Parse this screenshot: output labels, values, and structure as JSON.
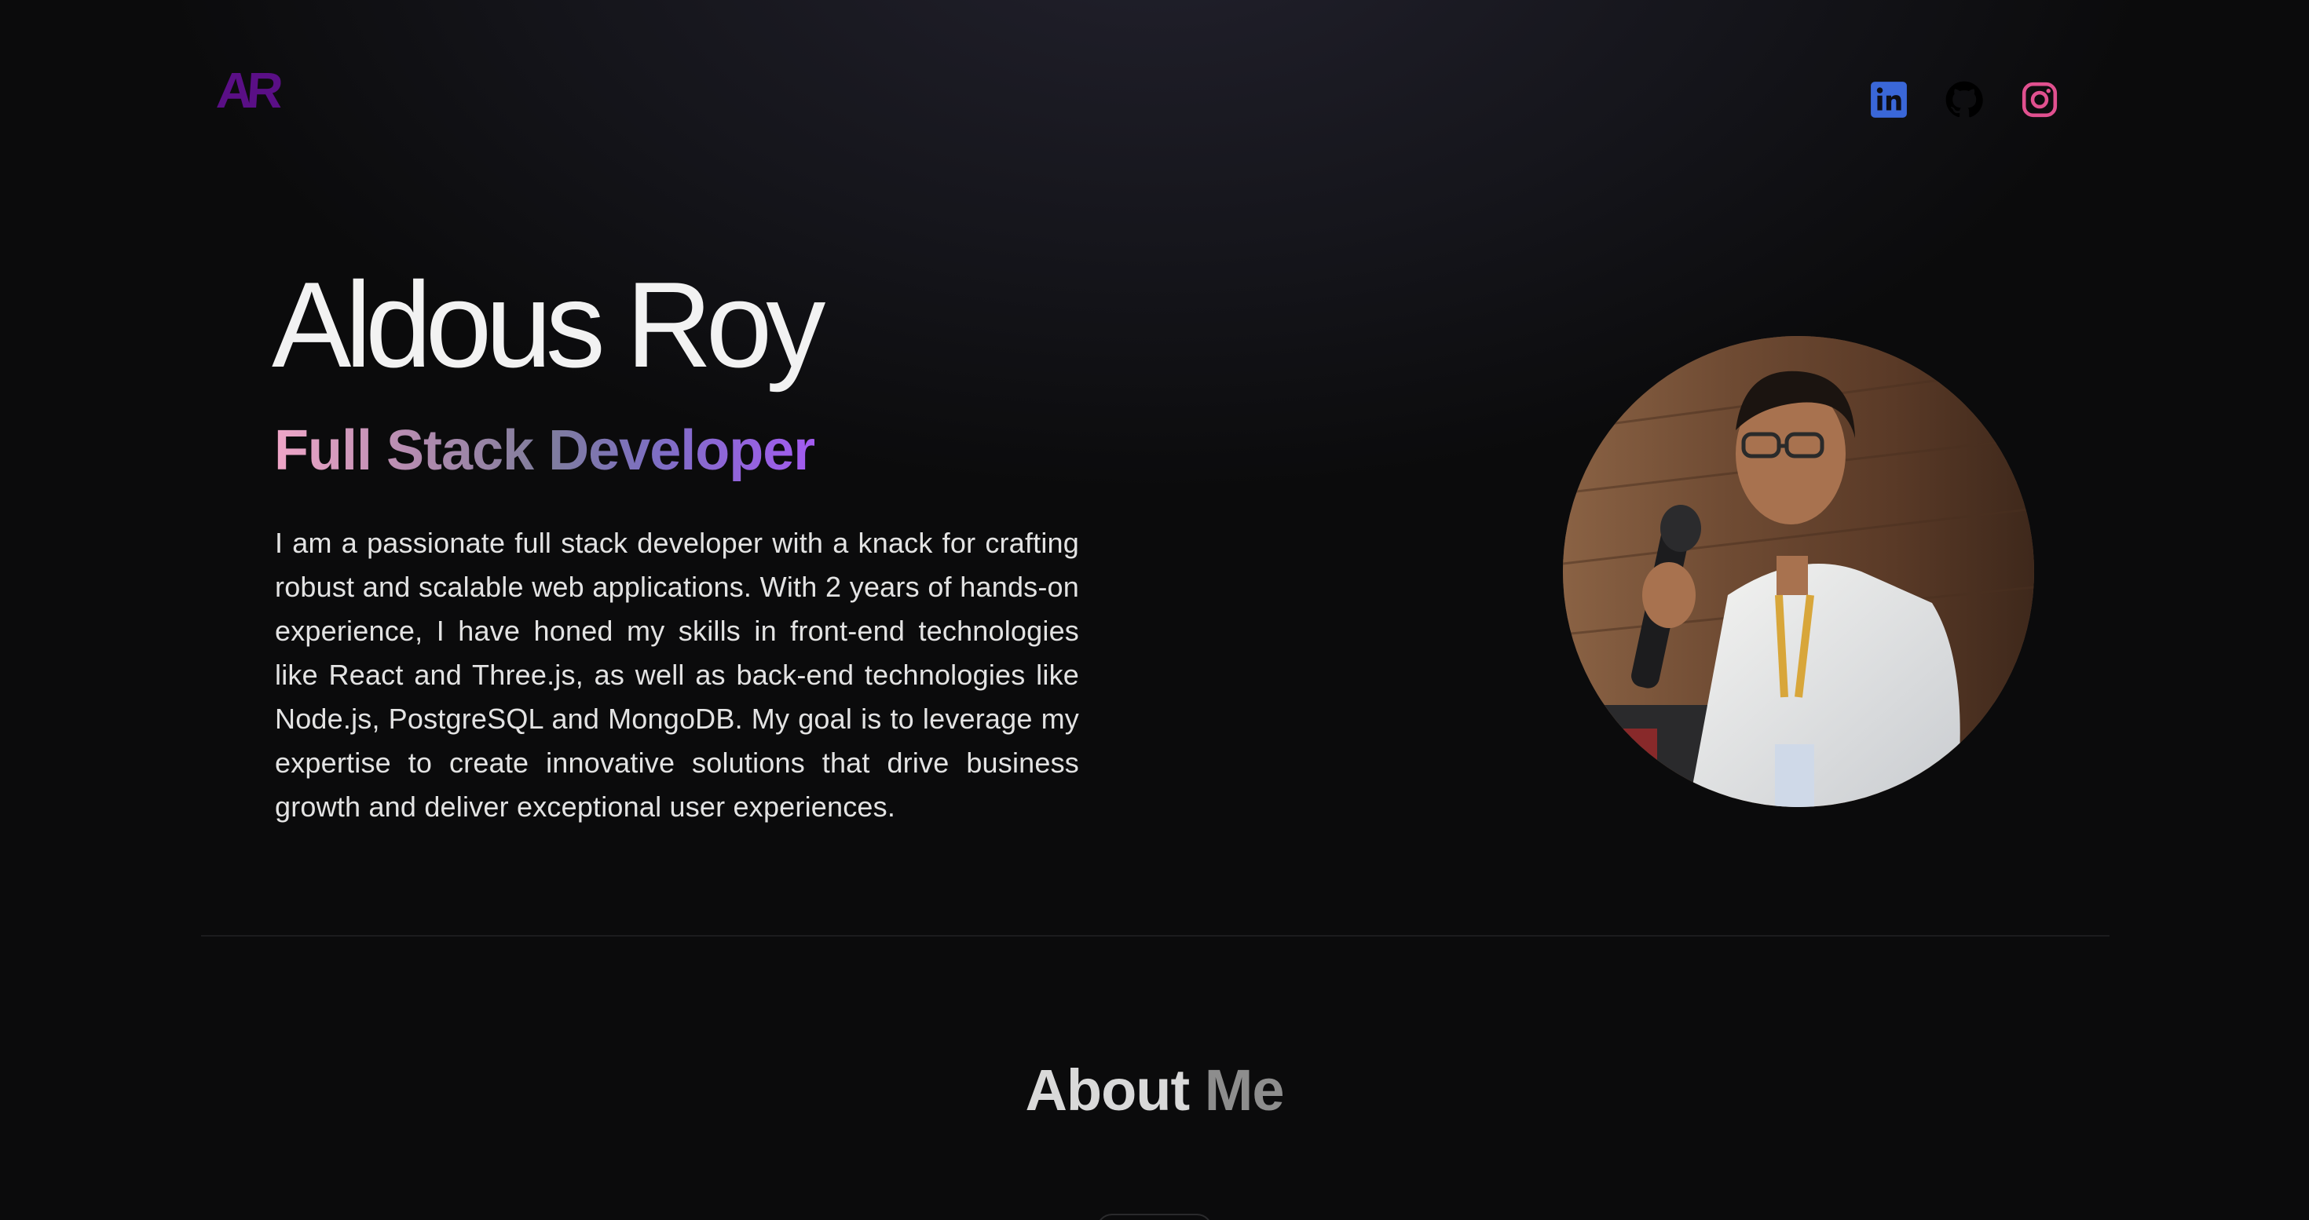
{
  "nav": {
    "logo_text": "AR",
    "social": [
      {
        "name": "LinkedIn",
        "icon": "linkedin-icon",
        "color": "#3a67d8"
      },
      {
        "name": "GitHub",
        "icon": "github-icon",
        "color": "#000000"
      },
      {
        "name": "Instagram",
        "icon": "instagram-icon",
        "color": "#e0508f"
      }
    ]
  },
  "hero": {
    "name": "Aldous Roy",
    "role": "Full Stack Developer",
    "bio": "I am a passionate full stack developer with a knack for crafting robust and scalable web applications. With 2 years of hands-on experience, I have honed my skills in front-end technologies like React and Three.js, as well as back-end technologies like Node.js, PostgreSQL and MongoDB. My goal is to leverage my expertise to create innovative solutions that drive business growth and deliver exceptional user experiences.",
    "role_gradient": [
      "#f0a6c8",
      "#7f7d9c",
      "#a35bf0"
    ]
  },
  "about": {
    "title_part1": "About",
    "title_part2": "Me"
  }
}
